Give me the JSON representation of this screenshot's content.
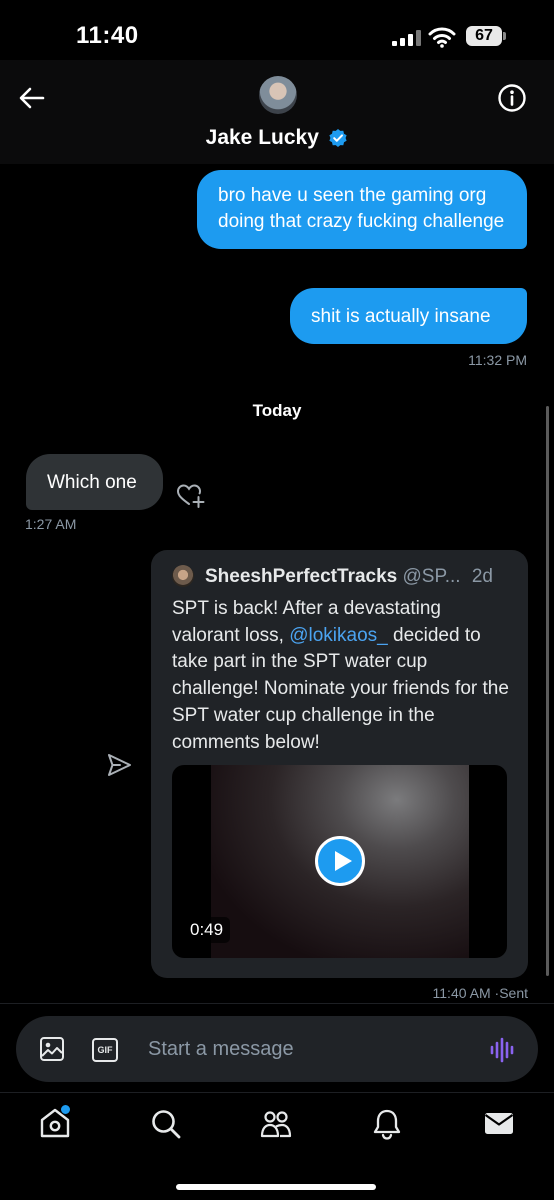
{
  "status_bar": {
    "time": "11:40",
    "battery": "67"
  },
  "header": {
    "contact_name": "Jake Lucky"
  },
  "messages": [
    {
      "text": "bro have u seen the gaming org doing that crazy fucking challenge"
    },
    {
      "text": "shit is actually insane",
      "time": "11:32 PM"
    }
  ],
  "date_divider": "Today",
  "incoming": {
    "text": "Which one",
    "time": "1:27 AM"
  },
  "shared_post": {
    "author": "SheeshPerfectTracks",
    "handle": "@SP...",
    "date": "2d",
    "text_before_mention": "SPT is back! After a devastating valorant loss, ",
    "mention": "@lokikaos_",
    "text_after_mention": " decided to take part in the SPT water cup challenge! Nominate your friends for the SPT water cup challenge in the comments below!",
    "video_duration": "0:49",
    "sent_time": "11:40 AM",
    "sent_status": "·Sent"
  },
  "composer": {
    "gif_label": "GIF",
    "placeholder": "Start a message"
  },
  "tabs": [
    "home-icon",
    "search-icon",
    "communities-icon",
    "notifications-icon",
    "messages-icon"
  ],
  "colors": {
    "accent": "#1d9bf0",
    "background": "#000000",
    "incoming_bubble": "#2f3336",
    "card": "#202327"
  }
}
